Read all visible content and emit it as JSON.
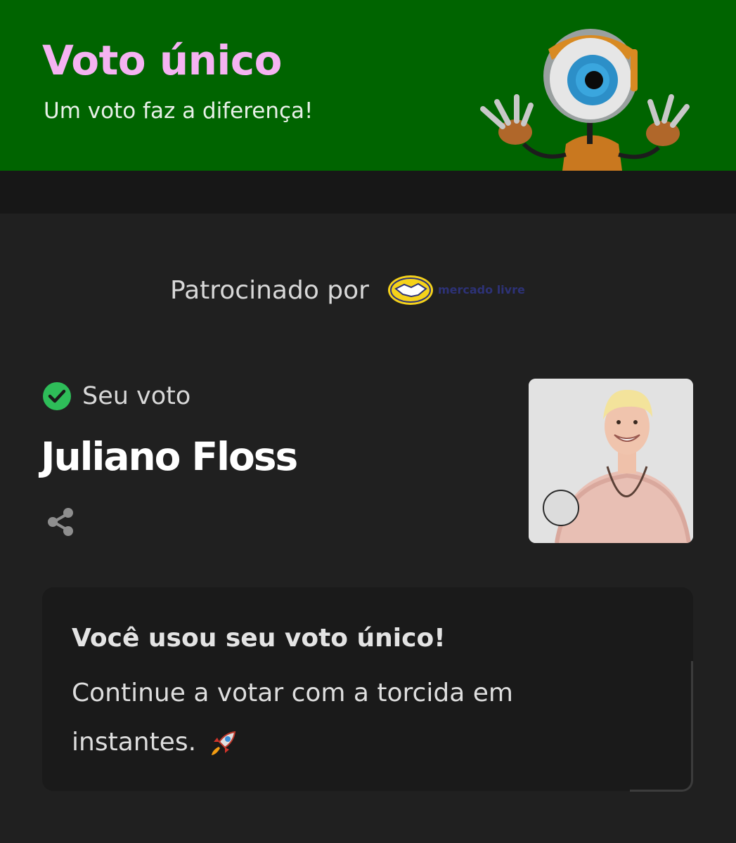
{
  "header": {
    "title": "Voto único",
    "subtitle": "Um voto faz a diferença!",
    "background_color": "#006400",
    "title_color": "#f5b3f2",
    "mascot_icon": "big-brother-eye-robot-mascot"
  },
  "sponsor": {
    "label": "Patrocinado por",
    "logo_name": "mercado livre",
    "logo_icon": "handshake-icon"
  },
  "vote": {
    "status_label": "Seu voto",
    "status_icon": "check-circle-icon",
    "status_color": "#2ebd59",
    "candidate_name": "Juliano Floss",
    "share_icon": "share-icon"
  },
  "card": {
    "title": "Você usou seu voto único!",
    "body": "Continue a votar com a torcida em instantes.",
    "emoji_icon": "rocket-icon"
  }
}
